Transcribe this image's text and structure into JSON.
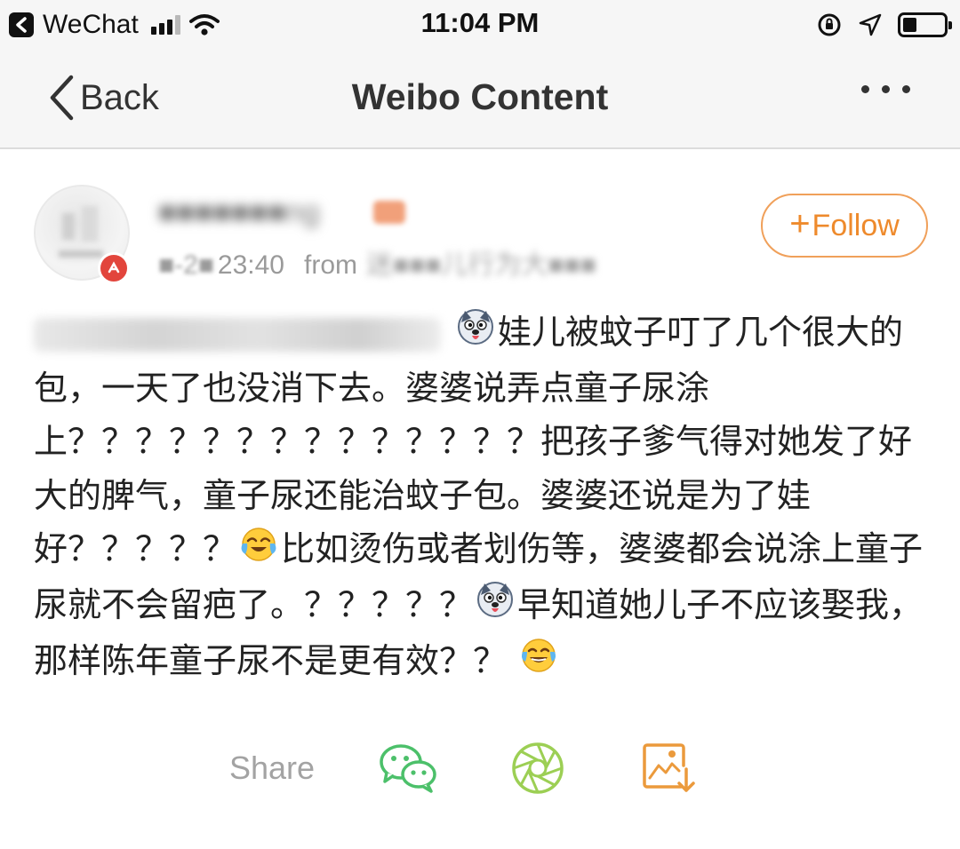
{
  "status_bar": {
    "app_name": "WeChat",
    "time": "11:04 PM",
    "signal_bars": 4,
    "signal_bars_active": 3,
    "battery_level": 0.35
  },
  "nav": {
    "back_label": "Back",
    "title": "Weibo Content"
  },
  "post": {
    "author_name": "■■■■■■■ng",
    "date": "■-2■",
    "time": "23:40",
    "from_label": "from",
    "source": "迷■■■儿行为大■■■",
    "follow_plus": "+",
    "follow_label": "Follow",
    "text_segments": [
      {
        "type": "emoji",
        "name": "husky-emoji"
      },
      {
        "type": "text",
        "value": "娃儿被蚊子叮了几个很大的包，一天了也没消下去。婆婆说弄点童子尿涂上？？？？？？？？？？？？？？把孩子爹气得对她发了好大的脾气，童子尿还能治蚊子包。婆婆还说是为了娃好？？？？？"
      },
      {
        "type": "emoji",
        "name": "crying-laughing-emoji"
      },
      {
        "type": "text",
        "value": "比如烫伤或者划伤等，婆婆都会说涂上童子尿就不会留疤了。？？？？？"
      },
      {
        "type": "emoji",
        "name": "husky-emoji"
      },
      {
        "type": "text",
        "value": "早知道她儿子不应该娶我，那样陈年童子尿不是更有效？？"
      },
      {
        "type": "emoji",
        "name": "tears-of-joy-emoji"
      }
    ]
  },
  "share": {
    "label": "Share",
    "icons": [
      "wechat-icon",
      "moments-icon",
      "save-image-icon"
    ],
    "colors": {
      "wechat": "#4cc06a",
      "moments": "#9ccf54",
      "save": "#eb9a3c"
    }
  },
  "colors": {
    "follow_accent": "#ee8a2c",
    "nav_bg": "#f6f6f6"
  }
}
